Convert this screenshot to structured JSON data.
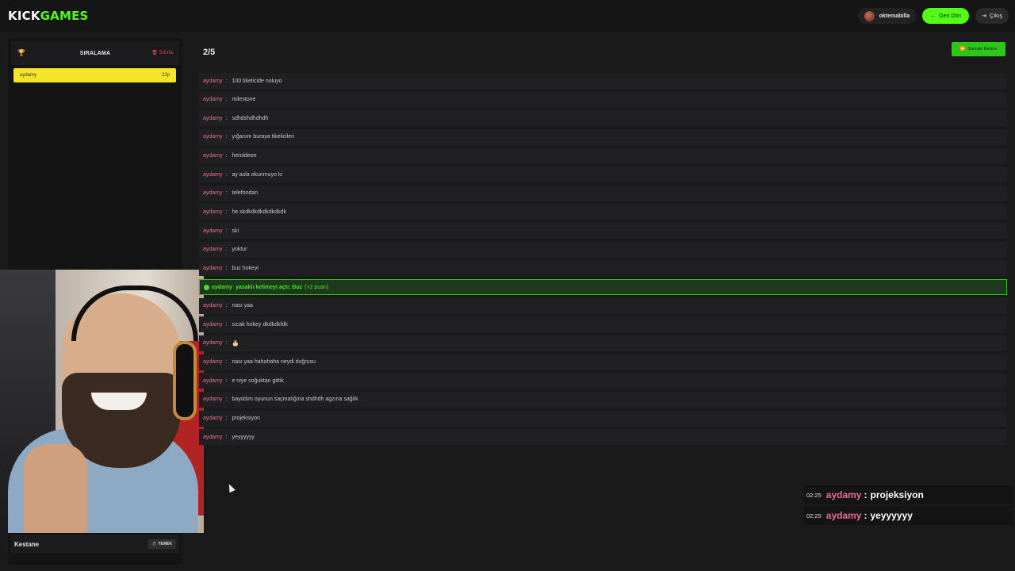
{
  "app": {
    "logo_kick": "KICK",
    "logo_games": "GAMES"
  },
  "header": {
    "username": "oktemabilla",
    "back_label": "Geri Dön",
    "exit_label": "Çıkış"
  },
  "leaderboard": {
    "title": "SIRALAMA",
    "reset_label": "Sıfırla",
    "rows": [
      {
        "name": "aydamy",
        "score": "22p"
      }
    ]
  },
  "category": {
    "item": "Kestane",
    "tag": "YEMEK"
  },
  "game": {
    "round": "2/5",
    "next_label": "Sonraki Kelime"
  },
  "messages": [
    {
      "user": "aydamy",
      "text": "100 tikelicide noluyo"
    },
    {
      "user": "aydamy",
      "text": "milestone"
    },
    {
      "user": "aydamy",
      "text": "sdhdshdhdhdh"
    },
    {
      "user": "aydamy",
      "text": "yığanım buraya tikelicileri"
    },
    {
      "user": "aydamy",
      "text": "heroldeee"
    },
    {
      "user": "aydamy",
      "text": "ay asla okunmuyo ki"
    },
    {
      "user": "aydamy",
      "text": "telefondan"
    },
    {
      "user": "aydamy",
      "text": "he skdkdkdkdkdkdkdk"
    },
    {
      "user": "aydamy",
      "text": "ski"
    },
    {
      "user": "aydamy",
      "text": "yoktur"
    },
    {
      "user": "aydamy",
      "text": "buz hokeyi"
    },
    {
      "user": "aydamy",
      "text": "nası yaa"
    },
    {
      "user": "aydamy",
      "text": "sıcak hokey dkdkdkfdk"
    },
    {
      "user": "aydamy",
      "text": "🎂"
    },
    {
      "user": "aydamy",
      "text": "nası yaa hahahaha neydi doğrusu"
    },
    {
      "user": "aydamy",
      "text": "e niye soğuktan gittik"
    },
    {
      "user": "aydamy",
      "text": "bayıldım oyunun saçmalığına shdhdh agzına sağlık"
    },
    {
      "user": "aydamy",
      "text": "projeksiyon"
    },
    {
      "user": "aydamy",
      "text": "yeyyyyyy"
    }
  ],
  "highlight": {
    "user": "aydamy",
    "text": "yasaklı kelimeyi açtı: Buz",
    "points": "(+2 puan)"
  },
  "overlay": [
    {
      "time": "02:25",
      "user": "aydamy",
      "text": "projeksiyon"
    },
    {
      "time": "02:25",
      "user": "aydamy",
      "text": "yeyyyyyy"
    }
  ],
  "colors": {
    "accent": "#53fc18",
    "username": "#f06a8c",
    "rank_bg": "#f5e52a",
    "reset": "#ff4d4d"
  }
}
